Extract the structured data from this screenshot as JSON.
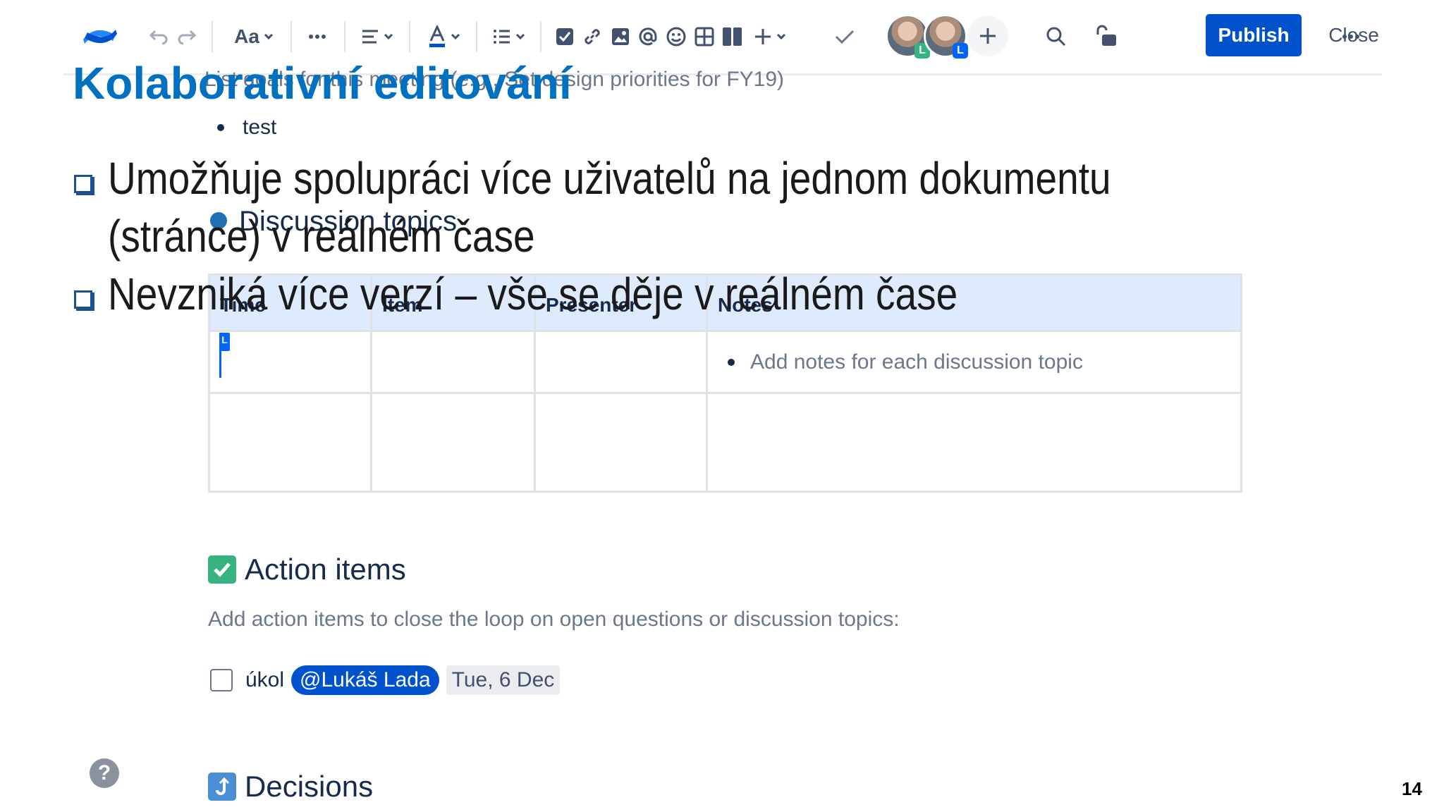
{
  "editor": {
    "toolbar": {
      "text_style_label": "Aa",
      "publish_label": "Publish",
      "close_label": "Close",
      "collaborators": [
        {
          "badge": "L",
          "badge_color": "#36b37e"
        },
        {
          "badge": "L",
          "badge_color": "#0065ff"
        }
      ]
    },
    "page": {
      "faded_line": "List goals for this meeting (e.g., Set design priorities for FY19)",
      "bullet": "test",
      "discussion_heading": "Discussion topics",
      "table": {
        "headers": [
          "Time",
          "Item",
          "Presenter",
          "Notes"
        ],
        "notes_placeholder": "Add notes for each discussion topic"
      },
      "cursor_flag": "L",
      "action_items": {
        "heading": "Action items",
        "description": "Add action items to close the loop on open questions or discussion topics:",
        "task": {
          "text": "úkol",
          "mention": "@Lukáš Lada",
          "date": "Tue, 6 Dec",
          "checked": false
        }
      },
      "decisions_heading": "Decisions"
    },
    "colors": {
      "brand": "#0052cc",
      "table_header_bg": "#deebff",
      "check_green": "#36b37e"
    }
  },
  "slide": {
    "title": "Kolaborativní editování",
    "bullets": [
      "Umožňuje spolupráci více uživatelů na jednom dokumentu (stránce) v reálném čase",
      "Nevzniká více verzí – vše se děje v reálném čase"
    ],
    "page_number": "14",
    "title_color": "#0070c0"
  }
}
